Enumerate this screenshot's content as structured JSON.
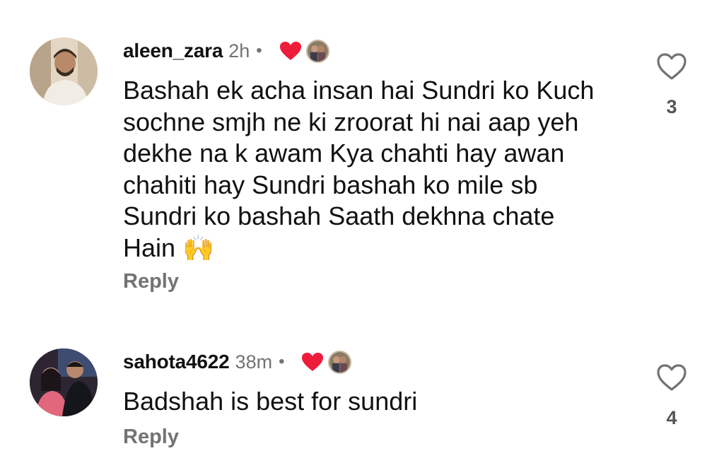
{
  "comments": [
    {
      "username": "aleen_zara",
      "time": "2h",
      "dot": "•",
      "text": "Bashah ek acha insan hai Sundri ko Kuch\nsochne smjh ne ki zroorat hi nai  aap yeh\ndekhe na k awam Kya chahti hay awan\nchahiti hay Sundri bashah ko mile sb\nSundri ko bashah Saath dekhna chate\nHain 🙌",
      "reply_label": "Reply",
      "like_count": "3",
      "icons": {
        "liked_by_creator": "heart-filled-icon",
        "creator_avatar": "creator-avatar",
        "like": "heart-outline-icon"
      }
    },
    {
      "username": "sahota4622",
      "time": "38m",
      "dot": "•",
      "text": "Badshah is best for sundri",
      "reply_label": "Reply",
      "like_count": "4",
      "icons": {
        "liked_by_creator": "heart-filled-icon",
        "creator_avatar": "creator-avatar",
        "like": "heart-outline-icon"
      }
    }
  ],
  "colors": {
    "liked_heart": "#ed1c3a",
    "secondary_text": "#737373",
    "primary_text": "#111111"
  }
}
